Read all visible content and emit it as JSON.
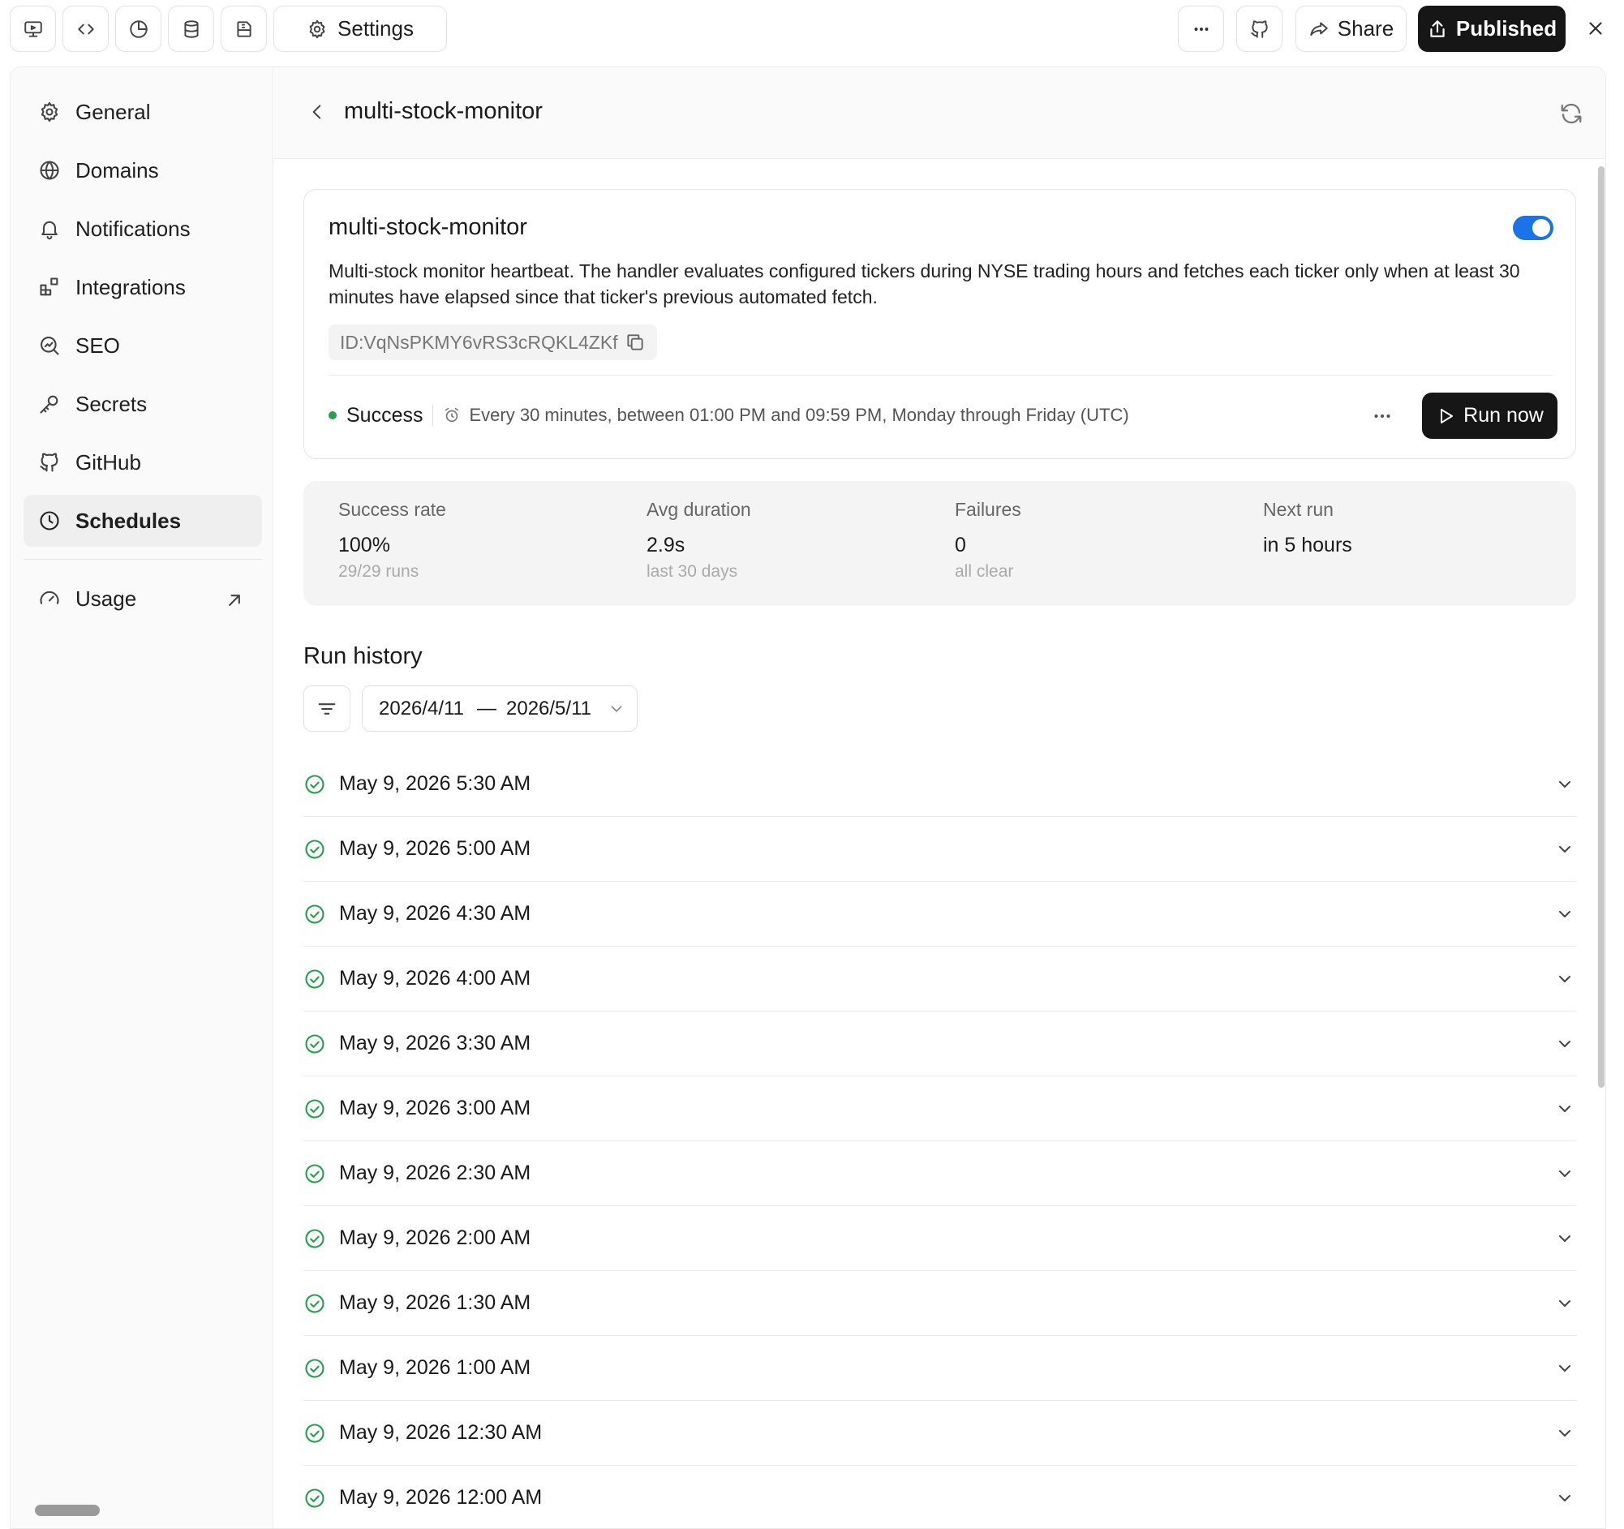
{
  "topbar": {
    "tool_icons": [
      "preview-icon",
      "code-icon",
      "analytics-icon",
      "database-icon",
      "storage-icon"
    ],
    "settings_label": "Settings",
    "share_label": "Share",
    "published_label": "Published"
  },
  "sidebar": {
    "items": [
      {
        "label": "General",
        "icon": "gear-icon"
      },
      {
        "label": "Domains",
        "icon": "globe-icon"
      },
      {
        "label": "Notifications",
        "icon": "bell-icon"
      },
      {
        "label": "Integrations",
        "icon": "integrations-icon"
      },
      {
        "label": "SEO",
        "icon": "seo-icon"
      },
      {
        "label": "Secrets",
        "icon": "key-icon"
      },
      {
        "label": "GitHub",
        "icon": "github-icon"
      },
      {
        "label": "Schedules",
        "icon": "clock-icon",
        "active": true
      }
    ],
    "usage_label": "Usage"
  },
  "header": {
    "title": "multi-stock-monitor"
  },
  "schedule": {
    "name": "multi-stock-monitor",
    "enabled": true,
    "description": "Multi-stock monitor heartbeat. The handler evaluates configured tickers during NYSE trading hours and fetches each ticker only when at least 30 minutes have elapsed since that ticker's previous automated fetch.",
    "id": "ID:VqNsPKMY6vRS3cRQKL4ZKf",
    "status": "Success",
    "status_color": "#22a14a",
    "schedule_text": "Every 30 minutes, between 01:00 PM and 09:59 PM, Monday through Friday (UTC)",
    "run_now_label": "Run now",
    "accent_color": "#1a73e8"
  },
  "stats": [
    {
      "label": "Success rate",
      "value": "100%",
      "sub": "29/29 runs"
    },
    {
      "label": "Avg duration",
      "value": "2.9s",
      "sub": "last 30 days"
    },
    {
      "label": "Failures",
      "value": "0",
      "sub": "all clear"
    },
    {
      "label": "Next run",
      "value": "in 5 hours",
      "sub": ""
    }
  ],
  "run_history": {
    "title": "Run history",
    "date_from": "2026/4/11",
    "date_sep": "—",
    "date_to": "2026/5/11",
    "runs": [
      "May 9, 2026 5:30 AM",
      "May 9, 2026 5:00 AM",
      "May 9, 2026 4:30 AM",
      "May 9, 2026 4:00 AM",
      "May 9, 2026 3:30 AM",
      "May 9, 2026 3:00 AM",
      "May 9, 2026 2:30 AM",
      "May 9, 2026 2:00 AM",
      "May 9, 2026 1:30 AM",
      "May 9, 2026 1:00 AM",
      "May 9, 2026 12:30 AM",
      "May 9, 2026 12:00 AM"
    ]
  }
}
